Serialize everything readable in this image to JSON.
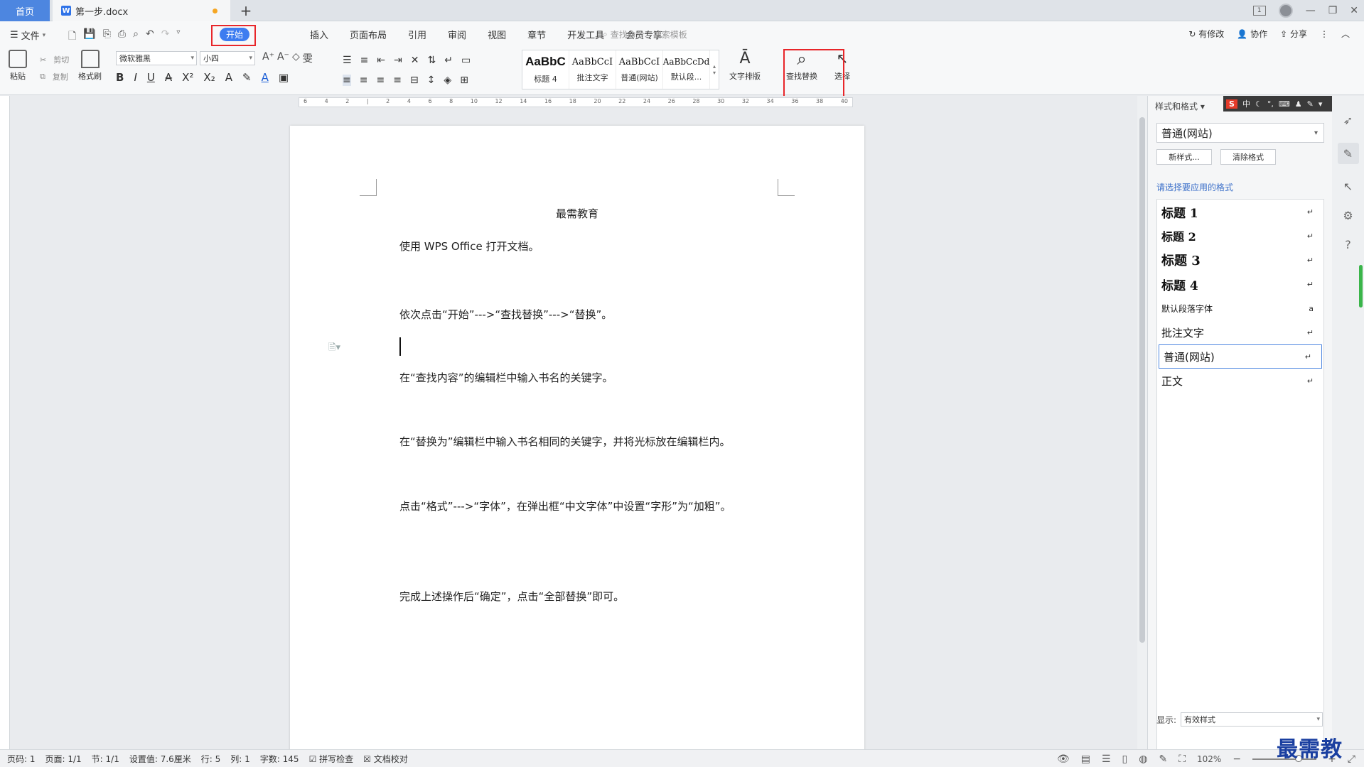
{
  "titlebar": {
    "home_tab": "首页",
    "doc_tab": "第一步.docx",
    "new_tab": "+",
    "page_count_badge": "1"
  },
  "menu": {
    "file": "文件",
    "tabs": [
      "开始",
      "插入",
      "页面布局",
      "引用",
      "审阅",
      "视图",
      "章节",
      "开发工具",
      "会员专享"
    ],
    "search_placeholder": "查找命令、搜索模板",
    "right_actions": [
      "有修改",
      "协作",
      "分享"
    ]
  },
  "ribbon": {
    "paste": "粘贴",
    "cut": "剪切",
    "copy": "复制",
    "format_painter": "格式刷",
    "font_name": "微软雅黑",
    "font_size": "小四",
    "styles": [
      {
        "sample": "AaBbC",
        "label": "标题 4"
      },
      {
        "sample": "AaBbCcI",
        "label": "批注文字"
      },
      {
        "sample": "AaBbCcI",
        "label": "普通(网站)"
      },
      {
        "sample": "AaBbCcDd",
        "label": "默认段..."
      }
    ],
    "text_layout": "文字排版",
    "find_replace": "查找替换",
    "select": "选择"
  },
  "document": {
    "title": "最需教育",
    "paragraphs": [
      "使用 WPS Office 打开文档。",
      "依次点击“开始”--->“查找替换”--->“替换”。",
      "在“查找内容”的编辑栏中输入书名的关键字。",
      "在“替换为”编辑栏中输入书名相同的关键字，并将光标放在编辑栏内。",
      "点击“格式”--->“字体”，在弹出框“中文字体”中设置“字形”为“加粗”。",
      "完成上述操作后“确定”，点击“全部替换”即可。"
    ]
  },
  "style_pane": {
    "title": "样式和格式",
    "current_style": "普通(网站)",
    "new_style_btn": "新样式...",
    "clear_format_btn": "清除格式",
    "subtitle": "请选择要应用的格式",
    "styles": [
      "标题  1",
      "标题  2",
      "标题  3",
      "标题  4",
      "默认段落字体",
      "批注文字",
      "普通(网站)",
      "正文"
    ],
    "show_label": "显示:",
    "show_value": "有效样式"
  },
  "statusbar": {
    "page_no": "页码: 1",
    "pages": "页面: 1/1",
    "section": "节: 1/1",
    "setting": "设置值: 7.6厘米",
    "row": "行: 5",
    "col": "列: 1",
    "words": "字数: 145",
    "spell": "拼写检查",
    "proof": "文档校对",
    "zoom": "102%"
  },
  "watermark": "最需教育",
  "colors": {
    "accent": "#3d7cf0",
    "highlight": "#e8262a"
  }
}
